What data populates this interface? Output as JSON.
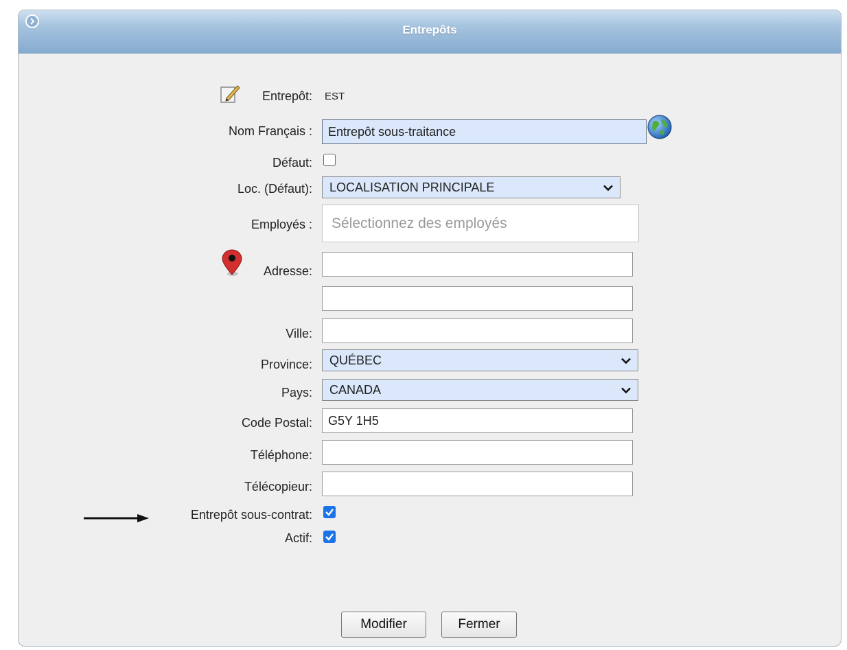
{
  "panel": {
    "title": "Entrepôts"
  },
  "form": {
    "entrepot": {
      "label": "Entrepôt:",
      "value": "EST"
    },
    "nom_francais": {
      "label": "Nom Français :",
      "value": "Entrepôt sous-traitance"
    },
    "defaut": {
      "label": "Défaut:",
      "checked": false
    },
    "localisation": {
      "label": "Loc. (Défaut):",
      "selected": "LOCALISATION PRINCIPALE"
    },
    "employes": {
      "label": "Employés :",
      "placeholder": "Sélectionnez des employés"
    },
    "adresse": {
      "label": "Adresse:",
      "line1": "",
      "line2": ""
    },
    "ville": {
      "label": "Ville:",
      "value": ""
    },
    "province": {
      "label": "Province:",
      "selected": "QUÉBEC"
    },
    "pays": {
      "label": "Pays:",
      "selected": "CANADA"
    },
    "code_postal": {
      "label": "Code Postal:",
      "value": "G5Y 1H5"
    },
    "telephone": {
      "label": "Téléphone:",
      "value": ""
    },
    "telecopieur": {
      "label": "Télécopieur:",
      "value": ""
    },
    "sous_contrat": {
      "label": "Entrepôt sous-contrat:",
      "checked": true
    },
    "actif": {
      "label": "Actif:",
      "checked": true
    }
  },
  "buttons": {
    "modify": "Modifier",
    "close": "Fermer"
  },
  "icons": {
    "collapse": "circle-chevron-right-icon",
    "edit": "pencil-edit-icon",
    "translate": "globe-icon",
    "map": "map-pin-icon",
    "pointer": "arrow-right-icon"
  },
  "colors": {
    "header": "#86abd0",
    "field_highlight": "#dbe8fb",
    "checkbox": "#1a73e8",
    "pin": "#d32f2f"
  }
}
